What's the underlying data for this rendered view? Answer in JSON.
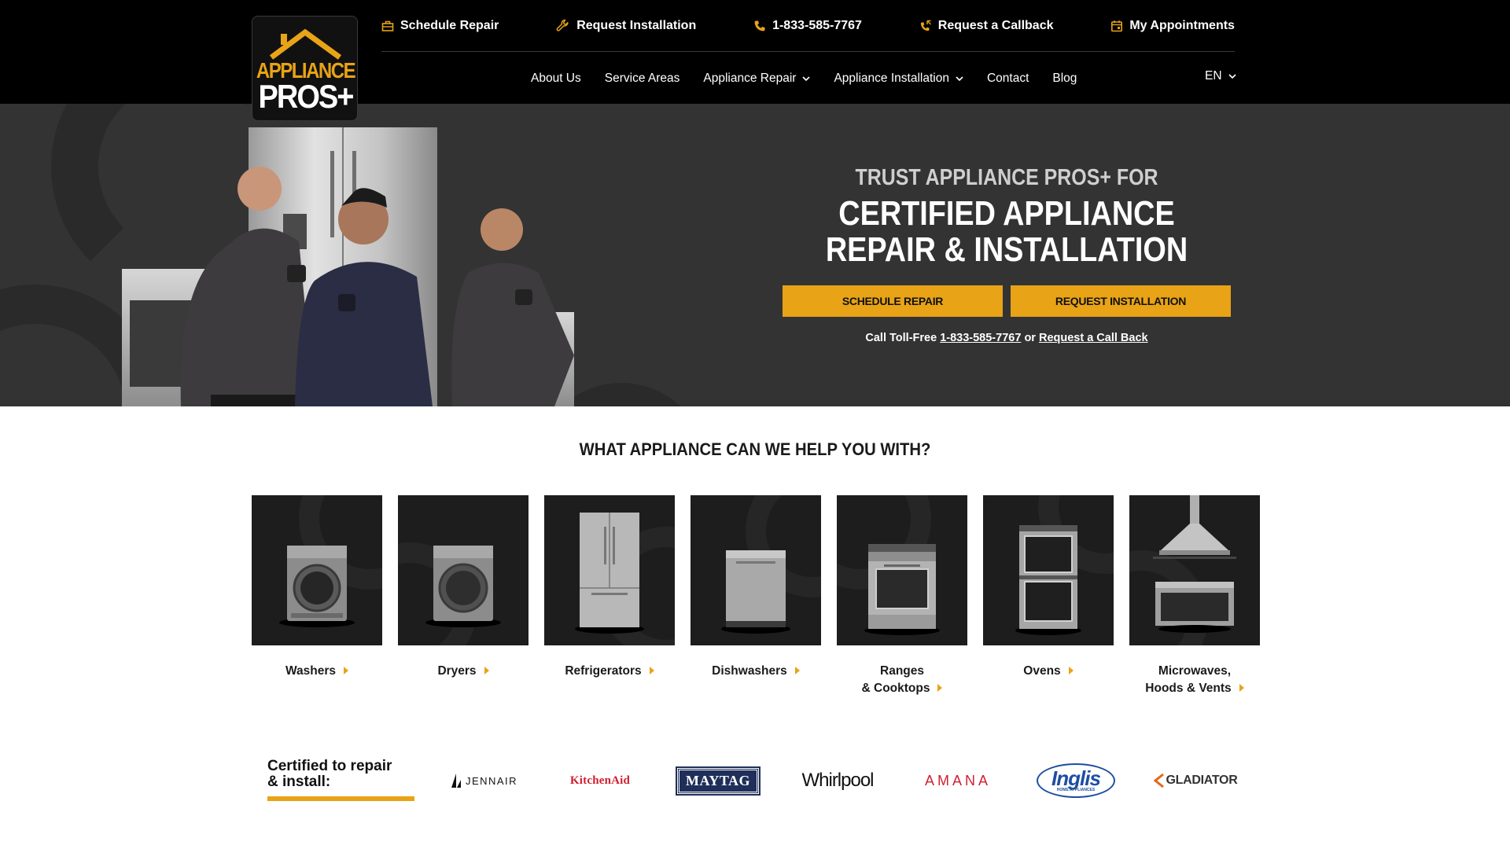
{
  "logo": {
    "line1": "APPLIANCE",
    "line2": "PROS+"
  },
  "utility": {
    "schedule_repair": "Schedule Repair",
    "request_installation": "Request Installation",
    "phone": "1-833-585-7767",
    "request_callback": "Request a Callback",
    "my_appointments": "My Appointments"
  },
  "nav": {
    "about": "About Us",
    "service_areas": "Service Areas",
    "appliance_repair": "Appliance Repair",
    "appliance_installation": "Appliance Installation",
    "contact": "Contact",
    "blog": "Blog",
    "language": "EN"
  },
  "hero": {
    "eyebrow": "TRUST APPLIANCE PROS+ FOR",
    "title_line1": "CERTIFIED APPLIANCE",
    "title_line2": "REPAIR & INSTALLATION",
    "btn_schedule": "SCHEDULE REPAIR",
    "btn_install": "REQUEST INSTALLATION",
    "call_prefix": "Call Toll-Free",
    "call_phone": "1-833-585-7767",
    "call_or": "or",
    "call_back": "Request a Call Back"
  },
  "appliances": {
    "title": "WHAT APPLIANCE CAN WE HELP YOU WITH?",
    "items": [
      {
        "line1": "Washers",
        "line2": ""
      },
      {
        "line1": "Dryers",
        "line2": ""
      },
      {
        "line1": "Refrigerators",
        "line2": ""
      },
      {
        "line1": "Dishwashers",
        "line2": ""
      },
      {
        "line1": "Ranges",
        "line2": "& Cooktops"
      },
      {
        "line1": "Ovens",
        "line2": ""
      },
      {
        "line1": "Microwaves,",
        "line2": "Hoods & Vents"
      }
    ]
  },
  "brands": {
    "label_line1": "Certified to repair",
    "label_line2": "& install:",
    "items": [
      "JENNAIR",
      "KitchenAid",
      "MAYTAG",
      "Whirlpool",
      "AMANA",
      "Inglis",
      "GLADIATOR"
    ],
    "inglis_sub": "HOME APPLIANCES"
  },
  "colors": {
    "accent": "#e8a317",
    "header": "#000000",
    "hero_bg": "#333333",
    "tile_bg": "#1d1d1d"
  }
}
